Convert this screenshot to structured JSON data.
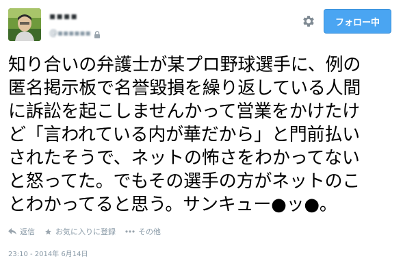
{
  "header": {
    "display_name": "▪▪▪▪",
    "screen_name": "@▪▪▪▪▪▪",
    "follow_label": "フォロー中",
    "avatar_icon": "user-avatar",
    "gear_icon": "gear-icon",
    "lock_icon": "lock-icon"
  },
  "tweet": {
    "lines": [
      "知り合いの弁護士が某プロ野球選手に、例の",
      "匿名掲示板で名誉毀損を繰り返している人間",
      "に訴訟を起こしませんかって営業をかけたけ",
      "ど「言われている内が華だから」と門前払い",
      "されたそうで、ネットの怖さをわかってない",
      "と怒ってた。でもその選手の方がネットのこ",
      "とわかってると思う。サンキュー●ッ●。"
    ]
  },
  "actions": {
    "reply_label": "返信",
    "favorite_label": "お気に入りに登録",
    "more_label": "その他"
  },
  "meta": {
    "timestamp": "23:10 - 2014年 6月14日"
  },
  "colors": {
    "follow_button_bg": "#4aa5f2",
    "muted_text": "#8899a6",
    "tweet_text": "#000000"
  }
}
